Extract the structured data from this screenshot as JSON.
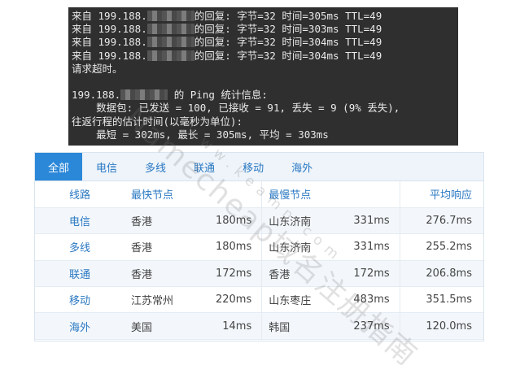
{
  "terminal": {
    "lines": [
      {
        "prefix": "来自 199.188.",
        "suffix": "的回复: 字节=32 时间=305ms TTL=49"
      },
      {
        "prefix": "来自 199.188.",
        "suffix": "的回复: 字节=32 时间=303ms TTL=49"
      },
      {
        "prefix": "来自 199.188.",
        "suffix": "的回复: 字节=32 时间=304ms TTL=49"
      },
      {
        "prefix": "来自 199.188.",
        "suffix": "的回复: 字节=32 时间=304ms TTL=49"
      }
    ],
    "timeout": "请求超时。",
    "stats_prefix": "199.188.",
    "stats_suffix": " 的 Ping 统计信息:",
    "packets": "    数据包: 已发送 = 100, 已接收 = 91, 丢失 = 9 (9% 丢失),",
    "rtt_title": "往返行程的估计时间(以毫秒为单位):",
    "rtt": "    最短 = 302ms, 最长 = 305ms, 平均 = 303ms"
  },
  "tabs": [
    "全部",
    "电信",
    "多线",
    "联通",
    "移动",
    "海外"
  ],
  "table": {
    "headers": {
      "line": "线路",
      "fastest": "最快节点",
      "slowest": "最慢节点",
      "avg": "平均响应"
    },
    "rows": [
      {
        "line": "电信",
        "fast_node": "香港",
        "fast_ms": "180ms",
        "slow_node": "山东济南",
        "slow_ms": "331ms",
        "avg": "276.7ms"
      },
      {
        "line": "多线",
        "fast_node": "香港",
        "fast_ms": "180ms",
        "slow_node": "山东济南",
        "slow_ms": "331ms",
        "avg": "255.2ms"
      },
      {
        "line": "联通",
        "fast_node": "香港",
        "fast_ms": "172ms",
        "slow_node": "香港",
        "slow_ms": "172ms",
        "avg": "206.8ms"
      },
      {
        "line": "移动",
        "fast_node": "江苏常州",
        "fast_ms": "220ms",
        "slow_node": "山东枣庄",
        "slow_ms": "483ms",
        "avg": "351.5ms"
      },
      {
        "line": "海外",
        "fast_node": "美国",
        "fast_ms": "14ms",
        "slow_node": "韩国",
        "slow_ms": "237ms",
        "avg": "120.0ms"
      }
    ]
  },
  "watermark": {
    "main": "Namecheap域名注册指南",
    "sub": "www.keamn.com"
  },
  "colors": {
    "accent": "#2b87d8",
    "link": "#2a78c2",
    "tab_bg": "#eef4fa",
    "terminal_bg": "#2f2f2f"
  }
}
